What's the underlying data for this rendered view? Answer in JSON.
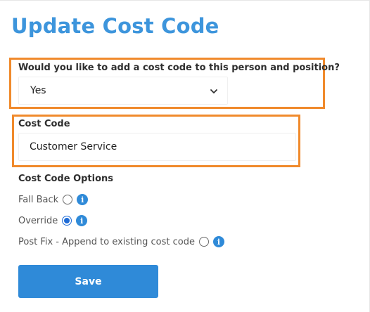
{
  "title": "Update Cost Code",
  "question": {
    "label": "Would you like to add a cost code to this person and position?",
    "selected": "Yes"
  },
  "cost_code": {
    "label": "Cost Code",
    "value": "Customer Service"
  },
  "options": {
    "title": "Cost Code Options",
    "items": [
      {
        "label": "Fall Back",
        "checked": false
      },
      {
        "label": "Override",
        "checked": true
      },
      {
        "label": "Post Fix - Append to existing cost code",
        "checked": false
      }
    ]
  },
  "save_label": "Save",
  "colors": {
    "accent": "#3d95dc",
    "button": "#2f8ad8",
    "highlight": "#f08a2c",
    "radio_selected": "#1e6bd6"
  }
}
